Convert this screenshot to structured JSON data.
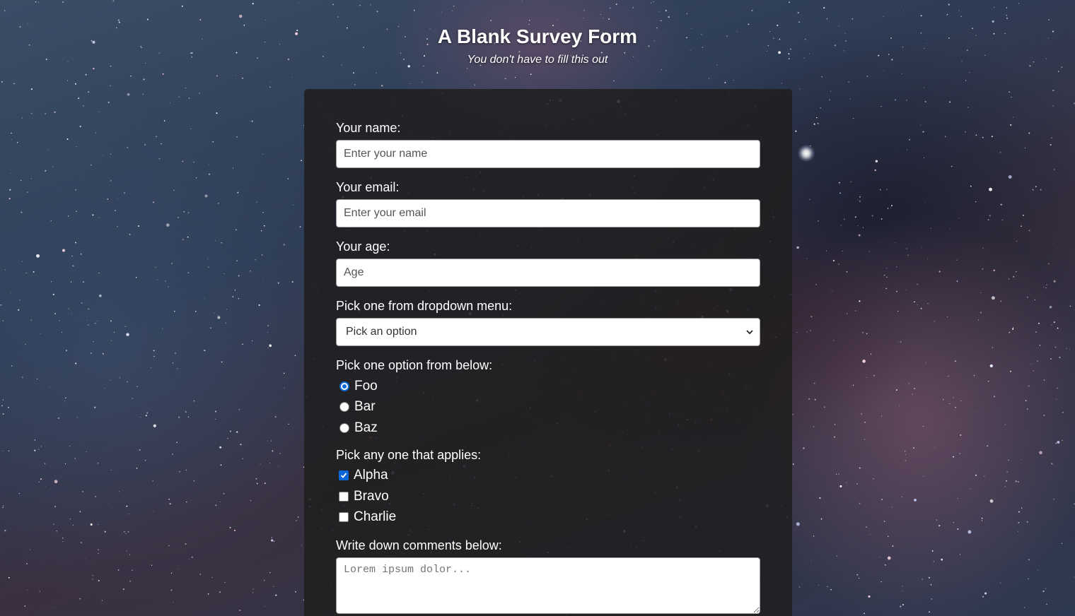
{
  "header": {
    "title": "A Blank Survey Form",
    "subtitle": "You don't have to fill this out"
  },
  "form": {
    "name": {
      "label": "Your name:",
      "placeholder": "Enter your name"
    },
    "email": {
      "label": "Your email:",
      "placeholder": "Enter your email"
    },
    "age": {
      "label": "Your age:",
      "placeholder": "Age"
    },
    "dropdown": {
      "label": "Pick one from dropdown menu:",
      "selected": "Pick an option"
    },
    "radio_group": {
      "label": "Pick one option from below:",
      "options": [
        {
          "label": "Foo",
          "checked": true
        },
        {
          "label": "Bar",
          "checked": false
        },
        {
          "label": "Baz",
          "checked": false
        }
      ]
    },
    "checkbox_group": {
      "label": "Pick any one that applies:",
      "options": [
        {
          "label": "Alpha",
          "checked": true
        },
        {
          "label": "Bravo",
          "checked": false
        },
        {
          "label": "Charlie",
          "checked": false
        }
      ]
    },
    "comments": {
      "label": "Write down comments below:",
      "placeholder": "Lorem ipsum dolor..."
    }
  },
  "colors": {
    "accent": "#0b67d6",
    "card_background": "#201e20"
  }
}
